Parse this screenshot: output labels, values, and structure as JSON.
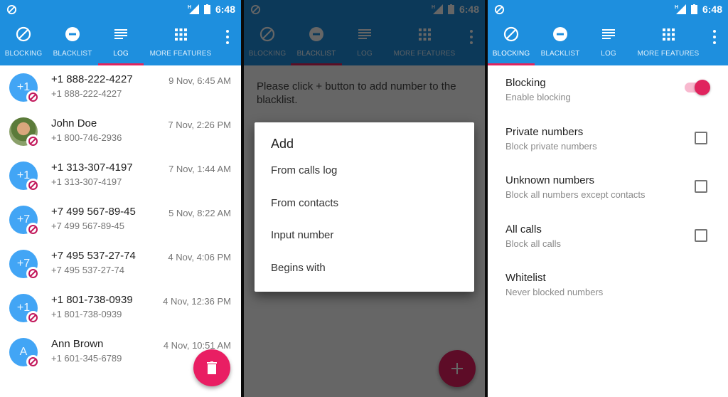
{
  "status_bar": {
    "time": "6:48",
    "network": "H"
  },
  "tabs": [
    {
      "label": "BLOCKING",
      "icon": "block-icon"
    },
    {
      "label": "BLACKLIST",
      "icon": "minus-circle-icon"
    },
    {
      "label": "LOG",
      "icon": "list-icon"
    },
    {
      "label": "MORE FEATURES",
      "icon": "grid-icon"
    }
  ],
  "colors": {
    "primary": "#1e8fde",
    "accent": "#e91e63",
    "avatar": "#42a5f5"
  },
  "screens": {
    "log": {
      "active_tab": "LOG",
      "entries": [
        {
          "avatar": "+1",
          "name": "+1 888-222-4227",
          "number": "+1 888-222-4227",
          "time": "9 Nov, 6:45 AM"
        },
        {
          "avatar": "photo",
          "name": "John Doe",
          "number": "+1 800-746-2936",
          "time": "7 Nov, 2:26 PM"
        },
        {
          "avatar": "+1",
          "name": "+1 313-307-4197",
          "number": "+1 313-307-4197",
          "time": "7 Nov, 1:44 AM"
        },
        {
          "avatar": "+7",
          "name": "+7 499 567-89-45",
          "number": "+7 499 567-89-45",
          "time": "5 Nov, 8:22 AM"
        },
        {
          "avatar": "+7",
          "name": "+7 495 537-27-74",
          "number": "+7 495 537-27-74",
          "time": "4 Nov, 4:06 PM"
        },
        {
          "avatar": "+1",
          "name": "+1 801-738-0939",
          "number": "+1 801-738-0939",
          "time": "4 Nov, 12:36 PM"
        },
        {
          "avatar": "A",
          "name": "Ann Brown",
          "number": "+1 601-345-6789",
          "time": "4 Nov, 10:51 AM"
        }
      ],
      "fab_icon": "trash-icon"
    },
    "blacklist": {
      "active_tab": "BLACKLIST",
      "hint": "Please click + button to add number to the blacklist.",
      "dialog": {
        "title": "Add",
        "items": [
          "From calls log",
          "From contacts",
          "Input number",
          "Begins with"
        ]
      },
      "fab_icon": "plus-icon"
    },
    "blocking": {
      "active_tab": "BLOCKING",
      "settings": [
        {
          "title": "Blocking",
          "subtitle": "Enable blocking",
          "control": "switch",
          "value": true
        },
        {
          "title": "Private numbers",
          "subtitle": "Block private numbers",
          "control": "checkbox",
          "value": false
        },
        {
          "title": "Unknown numbers",
          "subtitle": "Block all numbers except contacts",
          "control": "checkbox",
          "value": false
        },
        {
          "title": "All calls",
          "subtitle": "Block all calls",
          "control": "checkbox",
          "value": false
        },
        {
          "title": "Whitelist",
          "subtitle": "Never blocked numbers",
          "control": "none"
        }
      ]
    }
  }
}
